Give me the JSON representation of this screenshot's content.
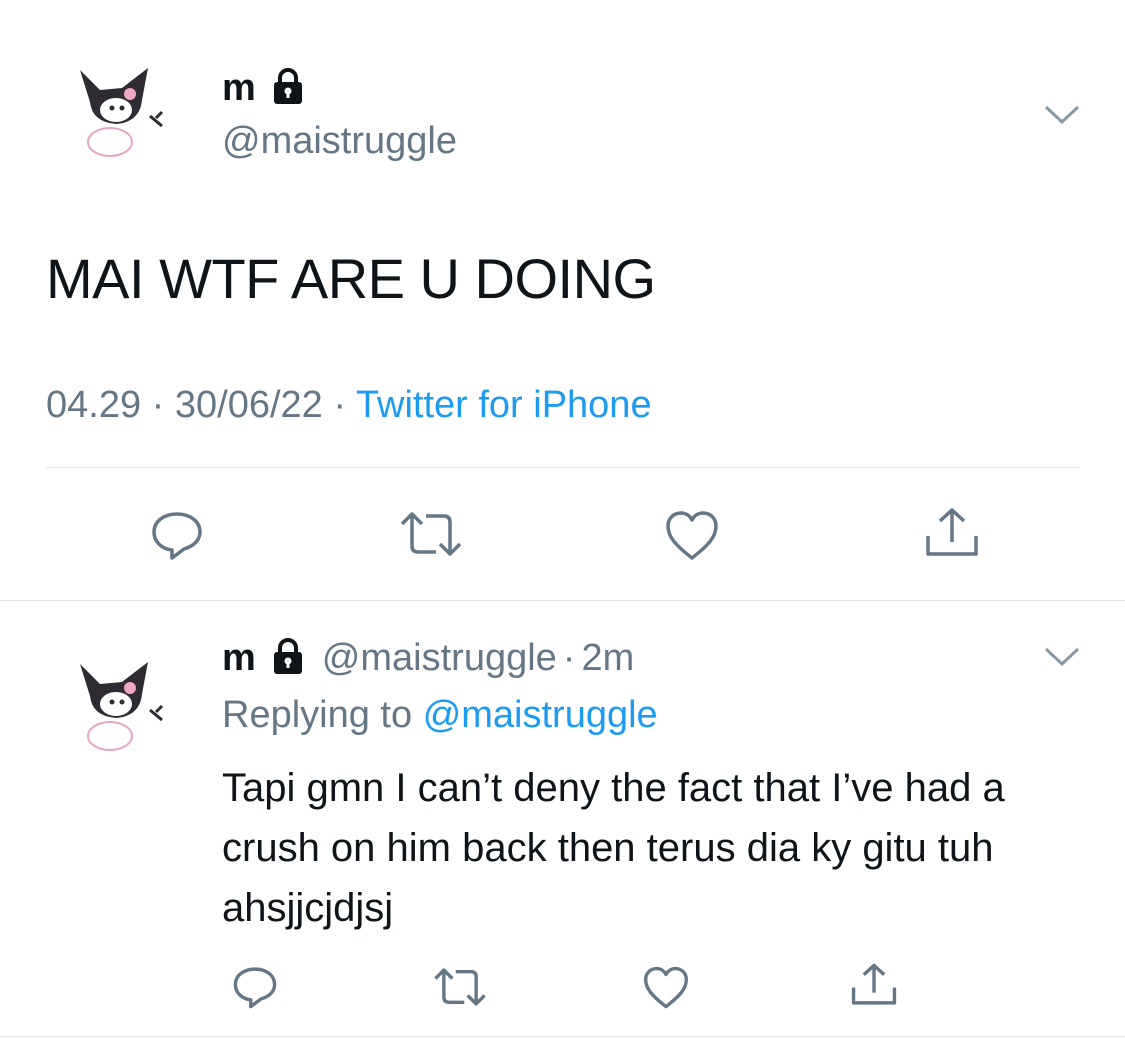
{
  "tweet": {
    "display_name": "m",
    "handle": "@maistruggle",
    "text": "MAI WTF ARE U DOING",
    "time": "04.29",
    "date": "30/06/22",
    "source": "Twitter for iPhone",
    "separator": "·"
  },
  "reply": {
    "display_name": "m",
    "handle": "@maistruggle",
    "separator": "·",
    "age": "2m",
    "replying_prefix": "Replying to",
    "replying_handle": "@maistruggle",
    "text": "Tapi gmn I can’t deny the fact that I’ve had a crush on him back then terus dia ky gitu tuh ahsjjcjdjsj"
  },
  "icons": [
    "lock-icon",
    "chevron-down-icon",
    "reply-icon",
    "retweet-icon",
    "like-icon",
    "share-icon"
  ],
  "colors": {
    "text": "#0f1419",
    "muted": "#657786",
    "link": "#1d9bf0",
    "divider": "#e1e4e8"
  }
}
